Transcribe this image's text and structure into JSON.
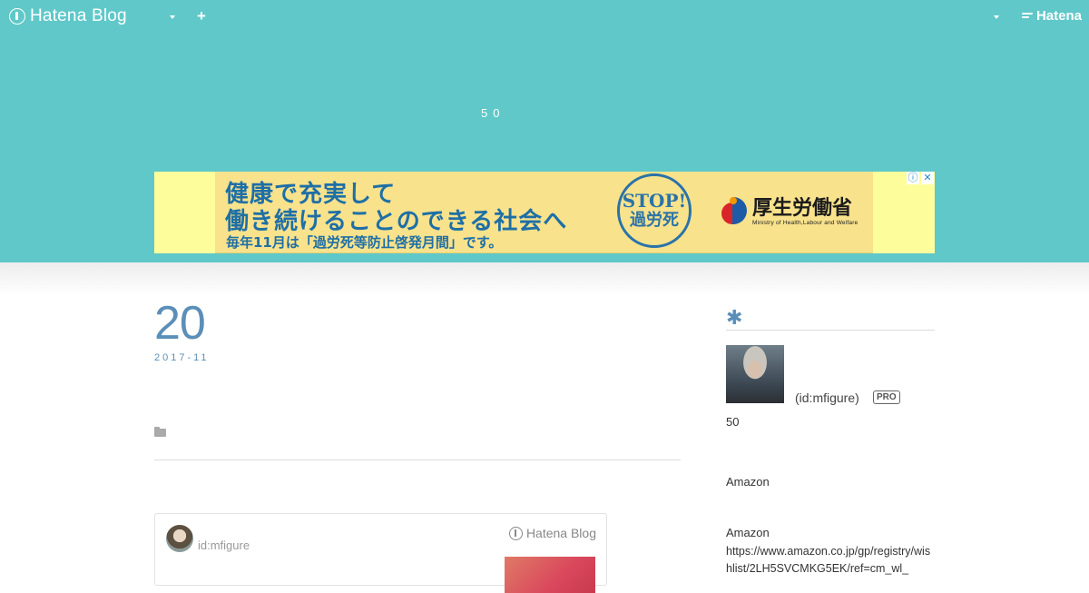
{
  "globalbar": {
    "brand": "Hatena Blog",
    "right_brand": "Hatena"
  },
  "header": {
    "blog_title": "50"
  },
  "ad": {
    "line1": "健康で充実して",
    "line2": "働き続けることのできる社会へ",
    "line3": "毎年11月は「過労死等防止啓発月間」です。",
    "badge_line1": "STOP!",
    "badge_line2": "過労死",
    "ministry_ja": "厚生労働省",
    "ministry_en": "Ministry of Health,Labour and Welfare",
    "info_glyph": "ⓘ",
    "close_glyph": "✕"
  },
  "article": {
    "date_day": "20",
    "date_year_month": "2017-11"
  },
  "embed": {
    "user": "id:mfigure",
    "brand": "Hatena Blog"
  },
  "sidebar": {
    "heading_glyph": "✱",
    "profile_id": "(id:mfigure)",
    "pro_badge": "PRO",
    "text_50": "50",
    "amazon_1": "Amazon",
    "amazon_2": "Amazon",
    "amazon_url": "https://www.amazon.co.jp/gp/registry/wishlist/2LH5SVCMKG5EK/ref=cm_wl_"
  },
  "colors": {
    "header_bg": "#60c8c9",
    "accent": "#5b8fb8",
    "ad_bg": "#fdfd9c",
    "ad_text": "#1e6fa6"
  },
  "icons": [
    "hatena-blog-logo-icon",
    "caret-down-icon",
    "plus-icon",
    "hatena-logo-icon",
    "folder-icon",
    "asterisk-icon",
    "info-icon",
    "close-icon"
  ]
}
